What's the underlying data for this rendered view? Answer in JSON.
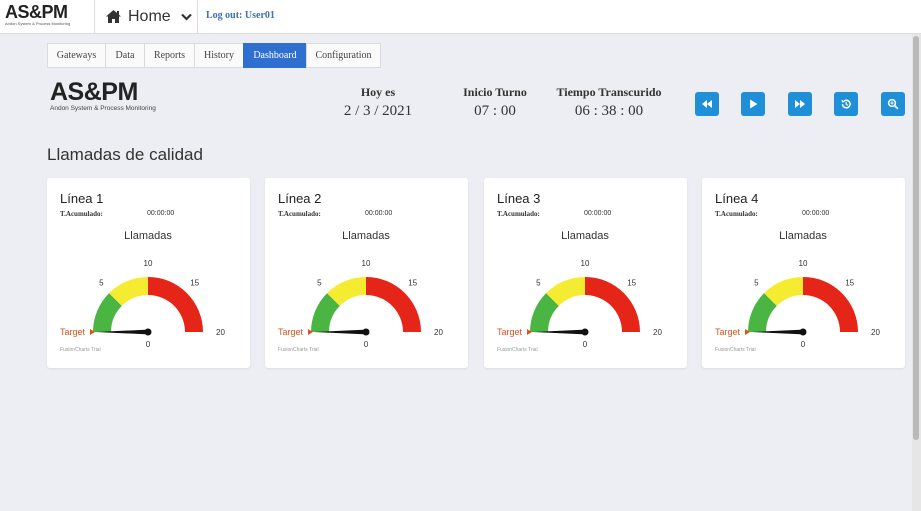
{
  "topbar": {
    "logo_main": "AS&PM",
    "logo_sub": "Andon System & Process Monitoring",
    "home_label": "Home",
    "logout_label": "Log out: User01"
  },
  "tabs": [
    {
      "label": "Gateways",
      "active": false
    },
    {
      "label": "Data",
      "active": false
    },
    {
      "label": "Reports",
      "active": false
    },
    {
      "label": "History",
      "active": false
    },
    {
      "label": "Dashboard",
      "active": true
    },
    {
      "label": "Configuration",
      "active": false
    }
  ],
  "brand": {
    "main": "AS&PM",
    "sub": "Andon System & Process Monitoring"
  },
  "info": {
    "date_label": "Hoy es",
    "date_value": "2 / 3 / 2021",
    "shift_label": "Inicio Turno",
    "shift_value": "07 : 00",
    "elapsed_label": "Tiempo Transcurido",
    "elapsed_value": "06 : 38 : 00"
  },
  "controls": [
    {
      "name": "rewind-button",
      "icon": "rewind-icon"
    },
    {
      "name": "play-button",
      "icon": "play-icon"
    },
    {
      "name": "fast-forward-button",
      "icon": "fast-forward-icon"
    },
    {
      "name": "reset-button",
      "icon": "history-icon"
    },
    {
      "name": "zoom-button",
      "icon": "zoom-icon"
    }
  ],
  "section_title": "Llamadas de calidad",
  "colors": {
    "accent": "#2f6fd0",
    "control": "#1f90d8",
    "gauge_green": "#4bb543",
    "gauge_yellow": "#f5ec32",
    "gauge_red": "#e42518",
    "target": "#d9541e"
  },
  "chart_data": [
    {
      "type": "gauge",
      "title": "Línea 1",
      "acc_label": "T.Acumulado:",
      "acc_value": "00:00:00",
      "caption": "Llamadas",
      "min": 0,
      "max": 20,
      "ticks": [
        0,
        5,
        10,
        15,
        20
      ],
      "bands": [
        {
          "from": 0,
          "to": 5,
          "color": "#4bb543"
        },
        {
          "from": 5,
          "to": 10,
          "color": "#f5ec32"
        },
        {
          "from": 10,
          "to": 20,
          "color": "#e42518"
        }
      ],
      "value": 0,
      "target_label": "Target",
      "target_value": 0,
      "trial": "FusionCharts Trial"
    },
    {
      "type": "gauge",
      "title": "Línea 2",
      "acc_label": "T.Acumulado:",
      "acc_value": "00:00:00",
      "caption": "Llamadas",
      "min": 0,
      "max": 20,
      "ticks": [
        0,
        5,
        10,
        15,
        20
      ],
      "bands": [
        {
          "from": 0,
          "to": 5,
          "color": "#4bb543"
        },
        {
          "from": 5,
          "to": 10,
          "color": "#f5ec32"
        },
        {
          "from": 10,
          "to": 20,
          "color": "#e42518"
        }
      ],
      "value": 0,
      "target_label": "Target",
      "target_value": 0,
      "trial": "FusionCharts Trial"
    },
    {
      "type": "gauge",
      "title": "Línea 3",
      "acc_label": "T.Acumulado:",
      "acc_value": "00:00:00",
      "caption": "Llamadas",
      "min": 0,
      "max": 20,
      "ticks": [
        0,
        5,
        10,
        15,
        20
      ],
      "bands": [
        {
          "from": 0,
          "to": 5,
          "color": "#4bb543"
        },
        {
          "from": 5,
          "to": 10,
          "color": "#f5ec32"
        },
        {
          "from": 10,
          "to": 20,
          "color": "#e42518"
        }
      ],
      "value": 0,
      "target_label": "Target",
      "target_value": 0,
      "trial": "FusionCharts Trial"
    },
    {
      "type": "gauge",
      "title": "Línea 4",
      "acc_label": "T.Acumulado:",
      "acc_value": "00:00:00",
      "caption": "Llamadas",
      "min": 0,
      "max": 20,
      "ticks": [
        0,
        5,
        10,
        15,
        20
      ],
      "bands": [
        {
          "from": 0,
          "to": 5,
          "color": "#4bb543"
        },
        {
          "from": 5,
          "to": 10,
          "color": "#f5ec32"
        },
        {
          "from": 10,
          "to": 20,
          "color": "#e42518"
        }
      ],
      "value": 0,
      "target_label": "Target",
      "target_value": 0,
      "trial": "FusionCharts Trial"
    }
  ]
}
